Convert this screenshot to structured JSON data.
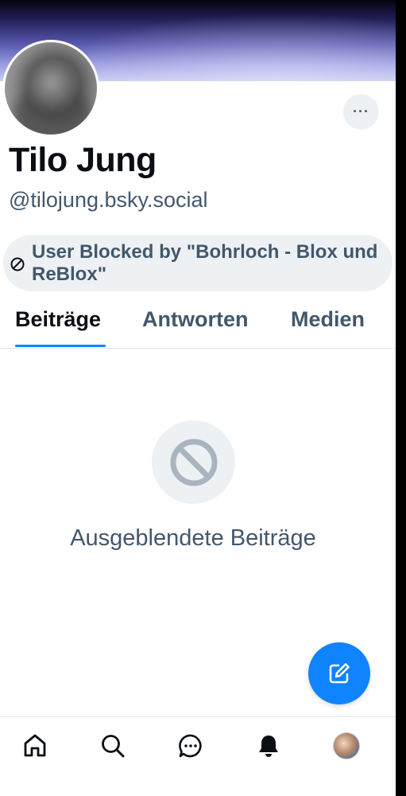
{
  "profile": {
    "display_name": "Tilo Jung",
    "handle": "@tilojung.bsky.social",
    "blocked_notice": "User Blocked by \"Bohrloch - Blox und ReBlox\"",
    "more_label": "···"
  },
  "tabs": [
    {
      "label": "Beiträge",
      "active": true
    },
    {
      "label": "Antworten",
      "active": false
    },
    {
      "label": "Medien",
      "active": false
    }
  ],
  "empty_state": {
    "icon": "ban-icon",
    "text": "Ausgeblendete Beiträge"
  },
  "fab": {
    "icon": "compose-icon"
  },
  "bottom_nav": [
    {
      "icon": "home-icon"
    },
    {
      "icon": "search-icon"
    },
    {
      "icon": "chat-icon"
    },
    {
      "icon": "bell-icon"
    },
    {
      "icon": "avatar"
    }
  ],
  "colors": {
    "accent": "#1083fe",
    "text_primary": "#0b0f14",
    "text_secondary": "#42576c",
    "pill_bg": "#eef1f4"
  }
}
